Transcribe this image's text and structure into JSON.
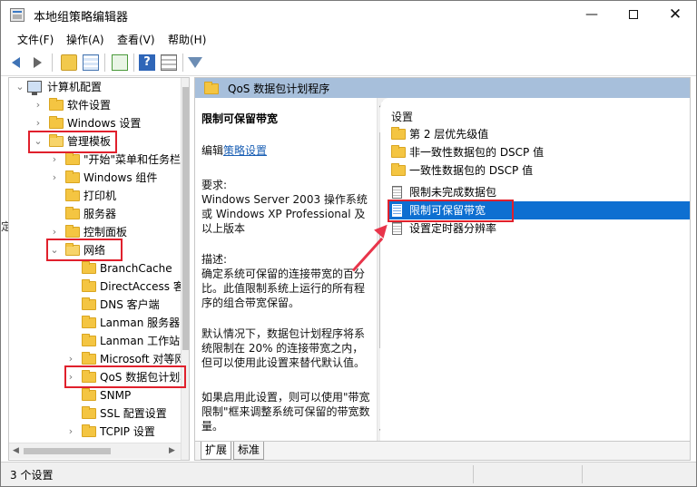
{
  "window": {
    "title": "本地组策略编辑器"
  },
  "menu": [
    "文件(F)",
    "操作(A)",
    "查看(V)",
    "帮助(H)"
  ],
  "toolbar": {
    "icons": [
      "back-arrow-icon",
      "forward-arrow-icon",
      "up-folder-icon",
      "show-hide-tree-icon",
      "export-list-icon",
      "help-icon",
      "view-icon",
      "filter-icon"
    ],
    "help_glyph": "?"
  },
  "tree": {
    "items": [
      {
        "label": "计算机配置",
        "expanded": true
      },
      {
        "label": "软件设置"
      },
      {
        "label": "Windows 设置"
      },
      {
        "label": "管理模板",
        "expanded": true
      },
      {
        "label": "\"开始\"菜单和任务栏"
      },
      {
        "label": "Windows 组件"
      },
      {
        "label": "打印机"
      },
      {
        "label": "服务器"
      },
      {
        "label": "控制面板"
      },
      {
        "label": "网络",
        "expanded": true
      },
      {
        "label": "BranchCache"
      },
      {
        "label": "DirectAccess 客户端"
      },
      {
        "label": "DNS 客户端"
      },
      {
        "label": "Lanman 服务器"
      },
      {
        "label": "Lanman 工作站"
      },
      {
        "label": "Microsoft 对等网络"
      },
      {
        "label": "QoS 数据包计划程序"
      },
      {
        "label": "SNMP"
      },
      {
        "label": "SSL 配置设置"
      },
      {
        "label": "TCPIP 设置"
      }
    ]
  },
  "right": {
    "header_title": "QoS 数据包计划程序",
    "description": {
      "title": "限制可保留带宽",
      "edit_prefix": "编辑",
      "edit_link": "策略设置",
      "requirements_label": "要求:",
      "requirements_text": "Windows Server 2003 操作系统或 Windows XP Professional 及以上版本",
      "description_label": "描述:",
      "description_text": "确定系统可保留的连接带宽的百分比。此值限制系统上运行的所有程序的组合带宽保留。",
      "default_text": "默认情况下，数据包计划程序将系统限制在 20% 的连接带宽之内，但可以使用此设置来替代默认值。",
      "more_text": "如果启用此设置，则可以使用\"带宽限制\"框来调整系统可保留的带宽数量。"
    },
    "settings_header": "设置",
    "settings": [
      {
        "label": "第 2 层优先级值",
        "type": "folder"
      },
      {
        "label": "非一致性数据包的 DSCP 值",
        "type": "folder"
      },
      {
        "label": "一致性数据包的 DSCP 值",
        "type": "folder"
      },
      {
        "label": "限制未完成数据包",
        "type": "policy"
      },
      {
        "label": "限制可保留带宽",
        "type": "policy",
        "selected": true
      },
      {
        "label": "设置定时器分辨率",
        "type": "policy"
      }
    ],
    "tabs": [
      "扩展",
      "标准"
    ]
  },
  "status": {
    "text": "3 个设置"
  },
  "edge_text": "定",
  "colors": {
    "selection": "#0e6fd1",
    "annotation": "#e0202c",
    "header": "#a7bfdb"
  }
}
